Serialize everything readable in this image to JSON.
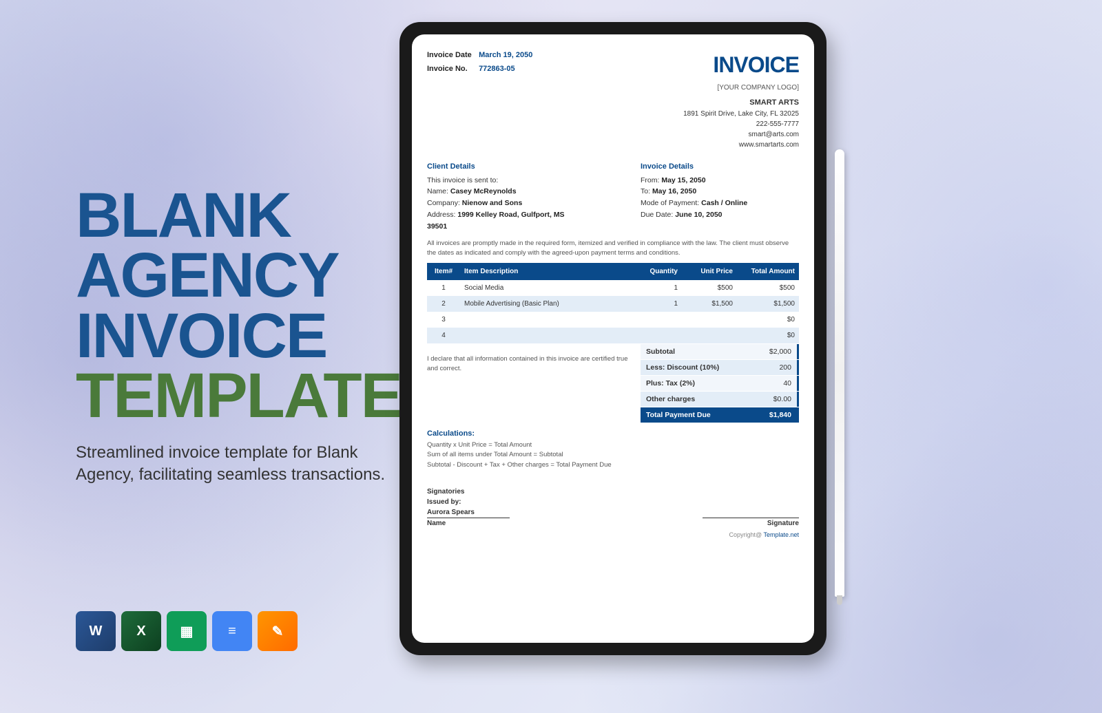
{
  "title": {
    "line1": "BLANK",
    "line2": "AGENCY",
    "line3": "INVOICE",
    "line4": "TEMPLATE"
  },
  "subtitle": "Streamlined invoice template for Blank Agency, facilitating seamless transactions.",
  "icons": {
    "word": "W",
    "excel": "X",
    "sheets": "▦",
    "docs": "≡",
    "pages": "✎"
  },
  "invoice": {
    "header": {
      "title": "INVOICE",
      "date_label": "Invoice Date",
      "date_value": "March 19, 2050",
      "no_label": "Invoice No.",
      "no_value": "772863-05",
      "logo_placeholder": "[YOUR COMPANY LOGO]",
      "company_name": "SMART ARTS",
      "address": "1891 Spirit Drive, Lake City, FL 32025",
      "phone": "222-555-7777",
      "email": "smart@arts.com",
      "website": "www.smartarts.com"
    },
    "client": {
      "heading": "Client Details",
      "sent_to": "This invoice is sent to:",
      "name_label": "Name:",
      "name_value": "Casey McReynolds",
      "company_label": "Company:",
      "company_value": "Nienow and Sons",
      "address_label": "Address:",
      "address_value": "1999 Kelley Road, Gulfport, MS 39501"
    },
    "details": {
      "heading": "Invoice Details",
      "from_label": "From:",
      "from_value": "May 15, 2050",
      "to_label": "To:",
      "to_value": "May 16, 2050",
      "mode_label": "Mode of Payment:",
      "mode_value": "Cash / Online",
      "due_label": "Due Date:",
      "due_value": "June 10, 2050"
    },
    "compliance_note": "All invoices are promptly made in the required form, itemized and verified in compliance with the law. The client must observe the dates as indicated and comply with the agreed-upon payment terms and conditions.",
    "table": {
      "headers": {
        "item": "Item#",
        "desc": "Item Description",
        "qty": "Quantity",
        "price": "Unit Price",
        "total": "Total Amount"
      },
      "rows": [
        {
          "num": "1",
          "desc": "Social Media",
          "qty": "1",
          "price": "$500",
          "total": "$500"
        },
        {
          "num": "2",
          "desc": "Mobile Advertising (Basic Plan)",
          "qty": "1",
          "price": "$1,500",
          "total": "$1,500"
        },
        {
          "num": "3",
          "desc": "",
          "qty": "",
          "price": "",
          "total": "$0"
        },
        {
          "num": "4",
          "desc": "",
          "qty": "",
          "price": "",
          "total": "$0"
        }
      ]
    },
    "declaration": "I declare that all information contained in this invoice are certified true and correct.",
    "totals": {
      "subtotal_label": "Subtotal",
      "subtotal_value": "$2,000",
      "discount_label": "Less: Discount (10%)",
      "discount_value": "200",
      "tax_label": "Plus: Tax (2%)",
      "tax_value": "40",
      "other_label": "Other charges",
      "other_value": "$0.00",
      "final_label": "Total Payment Due",
      "final_value": "$1,840"
    },
    "calculations": {
      "heading": "Calculations:",
      "line1": "Quantity x Unit Price = Total Amount",
      "line2": "Sum of all items under Total Amount = Subtotal",
      "line3": "Subtotal - Discount + Tax + Other charges = Total Payment Due"
    },
    "signatories": {
      "heading": "Signatories",
      "issued_by": "Issued by:",
      "name": "Aurora Spears",
      "name_label": "Name",
      "sig_label": "Signature"
    },
    "copyright": {
      "prefix": "Copyright@ ",
      "link": "Template.net"
    }
  }
}
